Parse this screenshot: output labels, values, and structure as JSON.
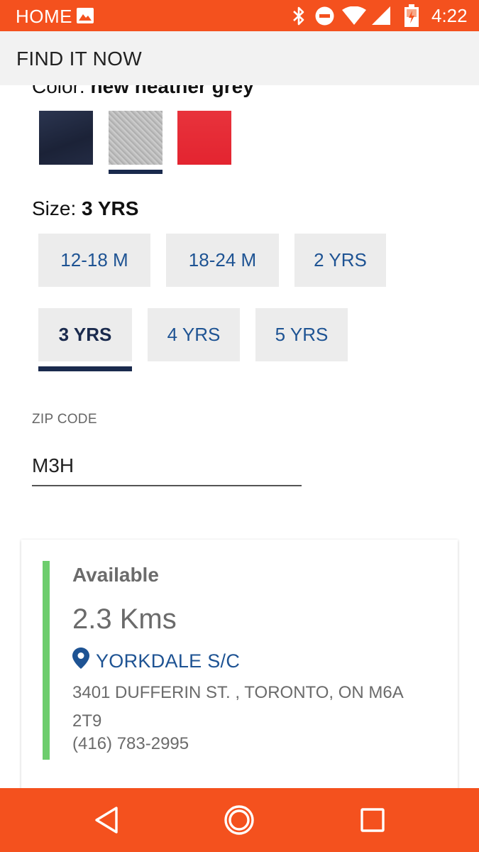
{
  "status_bar": {
    "home_label": "HOME",
    "time": "4:22",
    "icons": [
      "image-icon",
      "bluetooth-icon",
      "do-not-disturb-icon",
      "wifi-icon",
      "signal-icon",
      "battery-charging-icon"
    ]
  },
  "header": {
    "title": "FIND IT NOW",
    "close_icon": "close-icon"
  },
  "product": {
    "color_label": "Color:",
    "color_value": "new heather grey",
    "swatches": [
      {
        "name": "navy",
        "color": "#1f2740"
      },
      {
        "name": "grey",
        "color": "#bdbdbd",
        "selected": true
      },
      {
        "name": "red",
        "color": "#e32a35"
      }
    ],
    "size_label": "Size:",
    "size_value": "3 YRS",
    "sizes": [
      "12-18 M",
      "18-24 M",
      "2 YRS",
      "3 YRS",
      "4 YRS",
      "5 YRS"
    ],
    "selected_size": "3 YRS"
  },
  "zip": {
    "label": "ZIP CODE",
    "value": "M3H"
  },
  "store": {
    "availability": "Available",
    "distance": "2.3 Kms",
    "name": "YORKDALE S/C",
    "address": "3401 DUFFERIN ST. , TORONTO, ON M6A 2T9",
    "phone": "(416) 783-2995"
  },
  "nav_bar": {
    "buttons": [
      "back-icon",
      "home-icon",
      "recents-icon"
    ]
  },
  "colors": {
    "brand_orange": "#f4511e",
    "link_blue": "#1e5393",
    "selected_navy": "#1a2a4d",
    "available_green": "#6dcd6d"
  }
}
